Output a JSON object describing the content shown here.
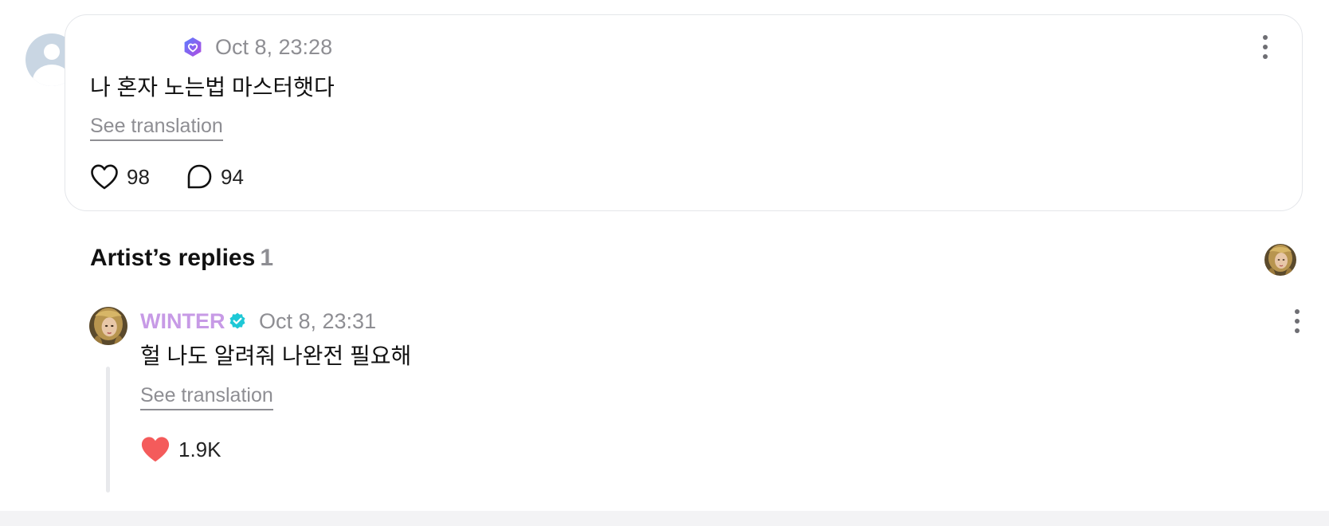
{
  "fan_post": {
    "author_name": "",
    "timestamp": "Oct 8, 23:28",
    "text": "나 혼자 노는법 마스터햇다",
    "see_translation_label": "See translation",
    "likes": "98",
    "comments": "94",
    "avatar_icon": "default-user-icon",
    "badge_icon": "membership-heart-badge-icon"
  },
  "artist_replies": {
    "heading": "Artist’s replies",
    "count": "1",
    "reply": {
      "author": "WINTER",
      "timestamp": "Oct 8, 23:31",
      "text": "헐 나도 알려줘 나완전 필요해",
      "see_translation_label": "See translation",
      "likes": "1.9K",
      "liked": true
    }
  },
  "colors": {
    "artist_name": "#c79ae6",
    "verified_badge": "#1ec8d6",
    "liked_heart": "#f45b5b",
    "muted_text": "#8e8e93",
    "card_border": "#e4e6ea",
    "avatar_placeholder": "#c9d6e3"
  }
}
